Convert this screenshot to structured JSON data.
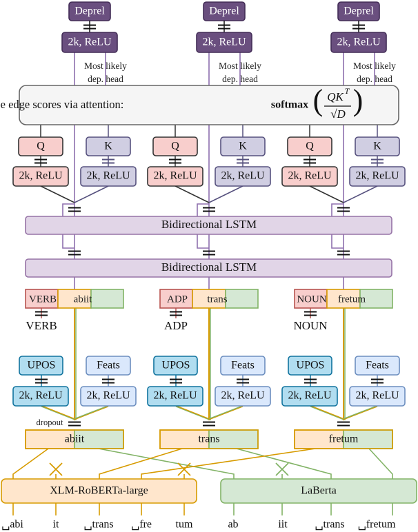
{
  "columns": [
    {
      "upos": "VERB",
      "word": "abiit",
      "pred": "VERB"
    },
    {
      "upos": "ADP",
      "word": "trans",
      "pred": "ADP"
    },
    {
      "upos": "NOUN",
      "word": "fretum",
      "pred": "NOUN"
    }
  ],
  "labels": {
    "deprel": "Deprel",
    "dense": "2k, ReLU",
    "head_note_1": "Most likely",
    "head_note_2": "dep. head",
    "q": "Q",
    "k": "K",
    "lstm": "Bidirectional LSTM",
    "upos": "UPOS",
    "feats": "Feats",
    "dropout": "dropout"
  },
  "attention": {
    "text": "Dependency tree edge scores via attention:",
    "func": "softmax",
    "numerator": "QK",
    "numerator_sup": "T",
    "denominator": "√D"
  },
  "models": [
    {
      "name": "XLM-RoBERTa-large",
      "color": "#ffe6cc",
      "stroke": "#d79b00"
    },
    {
      "name": "LaBerta",
      "color": "#d5e8d4",
      "stroke": "#82b366"
    }
  ],
  "subwords": [
    "␣abi",
    "it",
    "␣trans",
    "␣fre",
    "tum",
    "ab",
    "iit",
    "␣trans",
    "␣fretum"
  ],
  "colors": {
    "deprel": "#6a4f7f",
    "lstm": "#e1d5e7",
    "lstm_stroke": "#9673a6",
    "q": "#f8cecc",
    "k": "#d0cee2",
    "upos": "#b1ddf0",
    "feats": "#dae8fc",
    "red": "#f8cecc",
    "orange": "#ffe6cc",
    "green": "#d5e8d4"
  }
}
